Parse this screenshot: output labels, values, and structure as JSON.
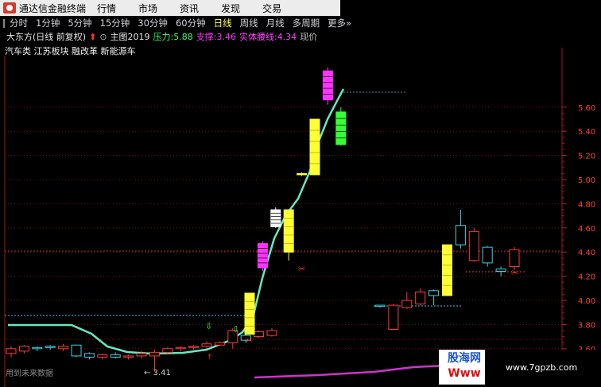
{
  "titlebar": {
    "app_name": "通达信金融终端",
    "menu": [
      "行情",
      "市场",
      "资讯",
      "发现",
      "交易"
    ]
  },
  "periods": {
    "items": [
      "分时",
      "1分钟",
      "5分钟",
      "15分钟",
      "30分钟",
      "60分钟",
      "日线",
      "周线",
      "月线",
      "多周期",
      "更多"
    ],
    "more_glyph": "»",
    "active": "日线"
  },
  "info": {
    "stock": "大东方(日线 前复权)",
    "main_chart": "主图2019",
    "pressure_label": "压力:",
    "pressure_value": "5.88",
    "support_label": "支撑:",
    "support_value": "3.46",
    "body_line_label": "实体腰线:",
    "body_line_value": "4.34",
    "price_label": "现价"
  },
  "concepts": "汽车类 江苏板块 融改革 新能源车",
  "price_axis": {
    "ticks": [
      "5.60",
      "5.40",
      "5.20",
      "5.00",
      "4.80",
      "4.60",
      "4.40",
      "4.20",
      "4.00",
      "3.80",
      "3.60"
    ]
  },
  "annotations": {
    "low_marker": "3.41"
  },
  "footer_note": "用到未来数据",
  "watermark": {
    "title": "股海网",
    "www": "Www",
    "url": "www.7gpzb.com"
  },
  "colors": {
    "up": "#ff3b3b",
    "down": "#3fd0e0",
    "yellow": "#ffff33",
    "magenta": "#ff33ff",
    "green": "#33ff33",
    "white": "#ffffff",
    "line": "#66e8c0",
    "pink": "#cc33cc",
    "grid": "#7a1010",
    "bg": "#000000"
  },
  "chart_data": {
    "type": "candlestick",
    "ylim": [
      3.41,
      5.88
    ],
    "candles": [
      {
        "o": 3.56,
        "c": 3.6,
        "h": 3.62,
        "l": 3.53,
        "style": "up"
      },
      {
        "o": 3.58,
        "c": 3.62,
        "h": 3.63,
        "l": 3.56,
        "style": "up"
      },
      {
        "o": 3.61,
        "c": 3.6,
        "h": 3.62,
        "l": 3.58,
        "style": "down"
      },
      {
        "o": 3.61,
        "c": 3.62,
        "h": 3.63,
        "l": 3.59,
        "style": "down"
      },
      {
        "o": 3.6,
        "c": 3.62,
        "h": 3.64,
        "l": 3.58,
        "style": "up"
      },
      {
        "o": 3.63,
        "c": 3.54,
        "h": 3.63,
        "l": 3.53,
        "style": "down"
      },
      {
        "o": 3.56,
        "c": 3.53,
        "h": 3.57,
        "l": 3.51,
        "style": "down"
      },
      {
        "o": 3.53,
        "c": 3.55,
        "h": 3.56,
        "l": 3.51,
        "style": "up"
      },
      {
        "o": 3.53,
        "c": 3.55,
        "h": 3.57,
        "l": 3.52,
        "style": "down"
      },
      {
        "o": 3.53,
        "c": 3.54,
        "h": 3.55,
        "l": 3.51,
        "style": "up"
      },
      {
        "o": 3.54,
        "c": 3.56,
        "h": 3.58,
        "l": 3.52,
        "style": "up"
      },
      {
        "o": 3.54,
        "c": 3.57,
        "h": 3.59,
        "l": 3.41,
        "style": "up"
      },
      {
        "o": 3.57,
        "c": 3.6,
        "h": 3.61,
        "l": 3.55,
        "style": "up"
      },
      {
        "o": 3.6,
        "c": 3.61,
        "h": 3.62,
        "l": 3.58,
        "style": "up"
      },
      {
        "o": 3.61,
        "c": 3.62,
        "h": 3.63,
        "l": 3.59,
        "style": "up"
      },
      {
        "o": 3.62,
        "c": 3.64,
        "h": 3.66,
        "l": 3.6,
        "style": "up"
      },
      {
        "o": 3.63,
        "c": 3.65,
        "h": 3.66,
        "l": 3.62,
        "style": "up"
      },
      {
        "o": 3.65,
        "c": 3.75,
        "h": 3.77,
        "l": 3.6,
        "style": "up"
      },
      {
        "o": 3.67,
        "c": 3.71,
        "h": 3.72,
        "l": 3.65,
        "style": "down"
      },
      {
        "o": 3.7,
        "c": 3.74,
        "h": 3.75,
        "l": 3.69,
        "style": "up"
      },
      {
        "o": 3.71,
        "c": 3.75,
        "h": 3.77,
        "l": 3.7,
        "style": "up"
      },
      {
        "o": 3.72,
        "c": 4.06,
        "h": 4.06,
        "l": 3.72,
        "style": "yellow"
      },
      {
        "o": 4.27,
        "c": 4.47,
        "h": 4.49,
        "l": 4.24,
        "style": "magenta"
      },
      {
        "o": 4.75,
        "c": 4.61,
        "h": 4.77,
        "l": 4.6,
        "style": "white"
      },
      {
        "o": 4.4,
        "c": 4.75,
        "h": 4.75,
        "l": 4.33,
        "style": "yellow"
      },
      {
        "o": 5.04,
        "c": 5.05,
        "h": 5.06,
        "l": 5.03,
        "style": "yellow"
      },
      {
        "o": 5.04,
        "c": 5.5,
        "h": 5.5,
        "l": 5.04,
        "style": "yellow"
      },
      {
        "o": 5.66,
        "c": 5.9,
        "h": 5.93,
        "l": 5.62,
        "style": "magenta"
      },
      {
        "o": 5.56,
        "c": 5.29,
        "h": 5.6,
        "l": 5.28,
        "style": "green"
      },
      {
        "o": 3.95,
        "c": 3.96,
        "h": 3.96,
        "l": 3.94,
        "style": "down"
      },
      {
        "o": 3.76,
        "c": 3.96,
        "h": 3.97,
        "l": 3.76,
        "style": "up"
      },
      {
        "o": 3.94,
        "c": 4.0,
        "h": 4.07,
        "l": 3.93,
        "style": "up"
      },
      {
        "o": 3.97,
        "c": 4.07,
        "h": 4.1,
        "l": 3.96,
        "style": "up"
      },
      {
        "o": 4.04,
        "c": 4.08,
        "h": 4.09,
        "l": 3.96,
        "style": "down"
      },
      {
        "o": 4.04,
        "c": 4.46,
        "h": 4.46,
        "l": 4.04,
        "style": "yellow"
      },
      {
        "o": 4.62,
        "c": 4.46,
        "h": 4.75,
        "l": 4.43,
        "style": "down"
      },
      {
        "o": 4.33,
        "c": 4.57,
        "h": 4.6,
        "l": 4.32,
        "style": "up"
      },
      {
        "o": 4.44,
        "c": 4.31,
        "h": 4.45,
        "l": 4.28,
        "style": "down"
      },
      {
        "o": 4.26,
        "c": 4.24,
        "h": 4.28,
        "l": 4.2,
        "style": "down"
      },
      {
        "o": 4.28,
        "c": 4.42,
        "h": 4.44,
        "l": 4.25,
        "style": "up"
      }
    ]
  }
}
